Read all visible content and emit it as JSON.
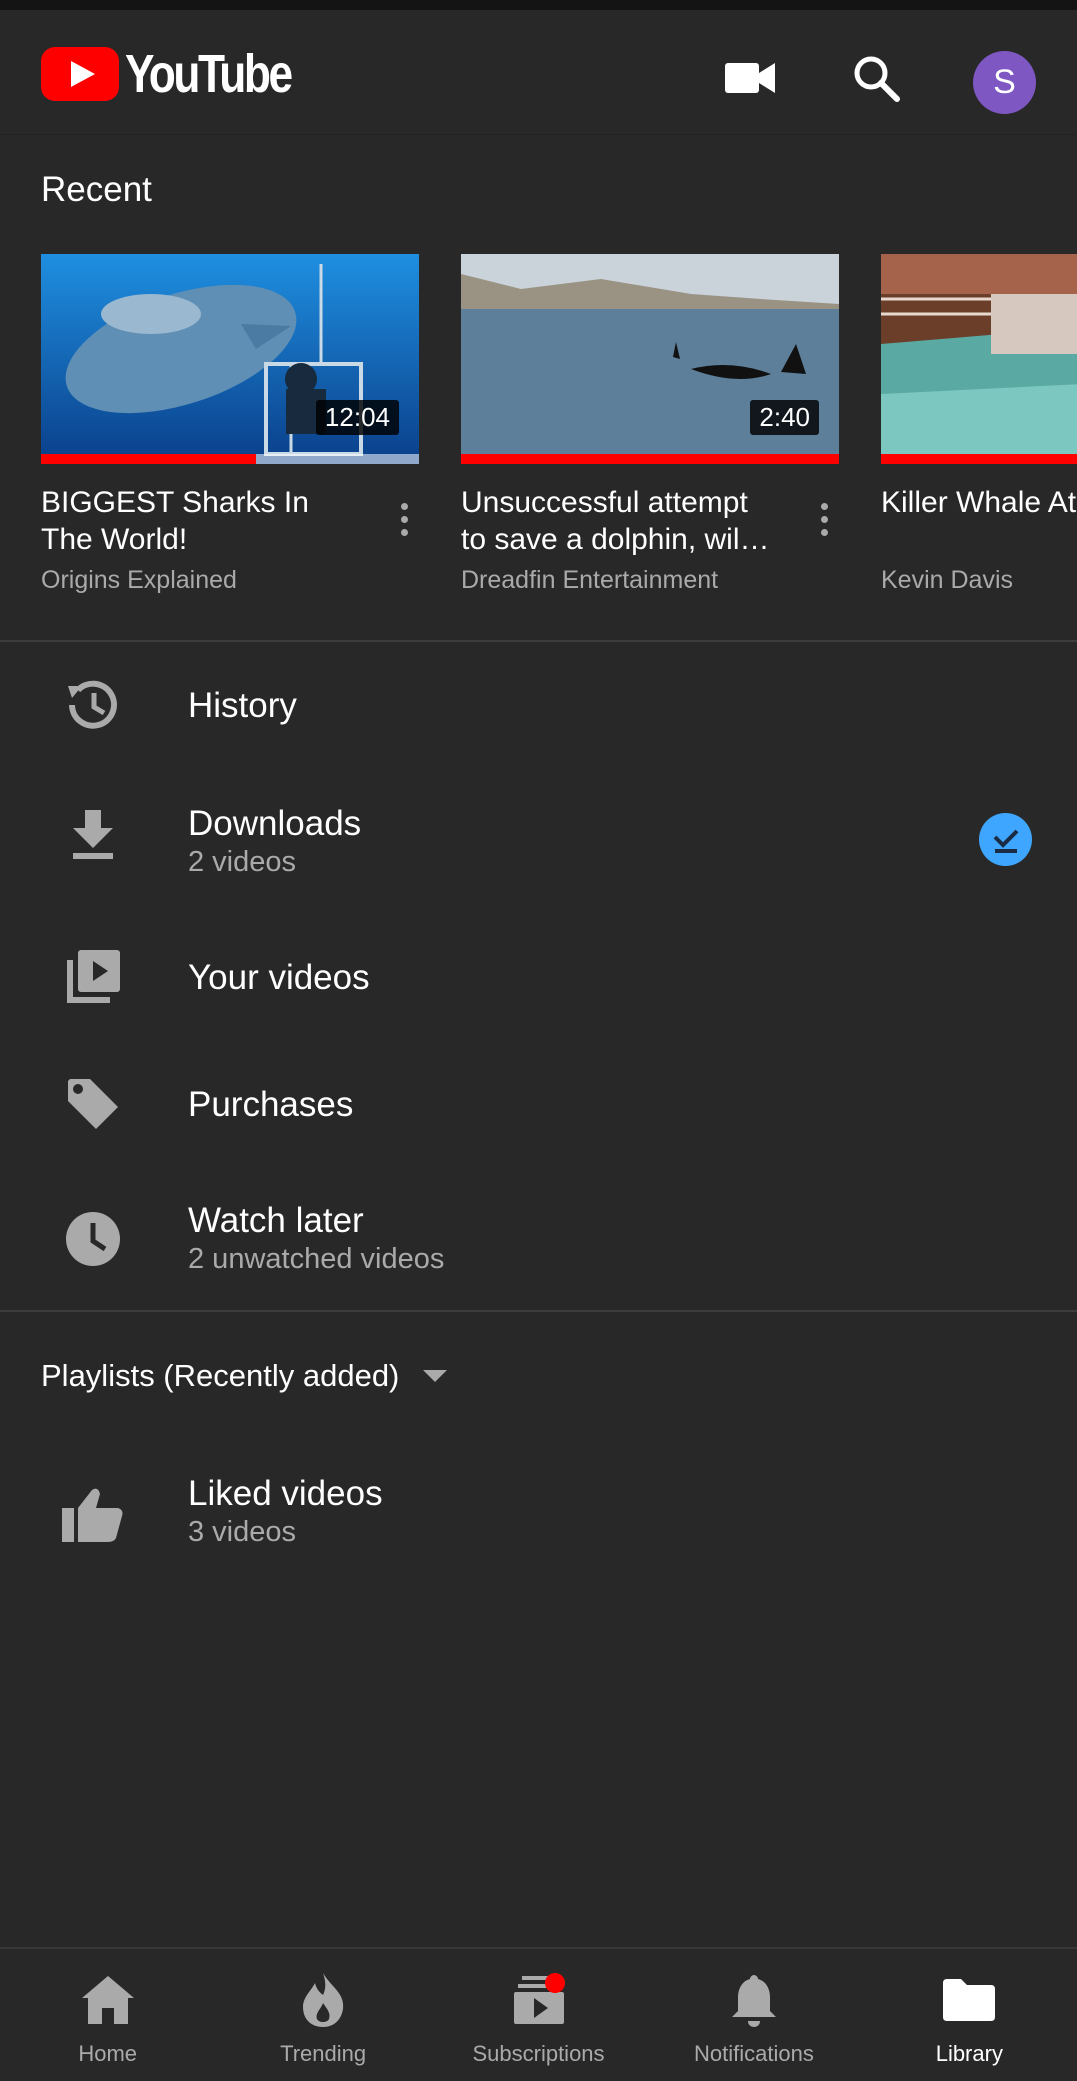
{
  "app": {
    "name": "YouTube"
  },
  "header": {
    "account_initial": "S",
    "icons": [
      "camera-icon",
      "search-icon"
    ]
  },
  "recent": {
    "title": "Recent",
    "videos": [
      {
        "title": "BIGGEST Sharks In The World!",
        "channel": "Origins Explained",
        "duration": "12:04",
        "watched_fraction": 0.57
      },
      {
        "title": "Unsuccessful attempt to save a dolphin, wil…",
        "channel": "Dreadfin Entertainment",
        "duration": "2:40",
        "watched_fraction": 1.0
      },
      {
        "title": "Killer Whale At at Sea World! U",
        "channel": "Kevin Davis",
        "duration": "",
        "watched_fraction": 1.0
      }
    ]
  },
  "library": {
    "items": [
      {
        "label": "History",
        "sub": "",
        "icon": "history-icon"
      },
      {
        "label": "Downloads",
        "sub": "2 videos",
        "icon": "download-icon"
      },
      {
        "label": "Your videos",
        "sub": "",
        "icon": "your-videos-icon"
      },
      {
        "label": "Purchases",
        "sub": "",
        "icon": "tag-icon"
      },
      {
        "label": "Watch later",
        "sub": "2 unwatched videos",
        "icon": "clock-icon"
      }
    ]
  },
  "playlists": {
    "header": "Playlists (Recently added)",
    "items": [
      {
        "label": "Liked videos",
        "sub": "3 videos",
        "icon": "thumbs-up-icon"
      }
    ]
  },
  "bottom_nav": {
    "items": [
      {
        "label": "Home",
        "icon": "home-icon"
      },
      {
        "label": "Trending",
        "icon": "flame-icon"
      },
      {
        "label": "Subscriptions",
        "icon": "subscriptions-icon"
      },
      {
        "label": "Notifications",
        "icon": "bell-icon"
      },
      {
        "label": "Library",
        "icon": "folder-icon"
      }
    ],
    "active": "Library"
  },
  "colors": {
    "accent": "#ff0000",
    "background": "#282828",
    "avatar": "#7e57c2",
    "download_badge": "#3ea6ff"
  }
}
